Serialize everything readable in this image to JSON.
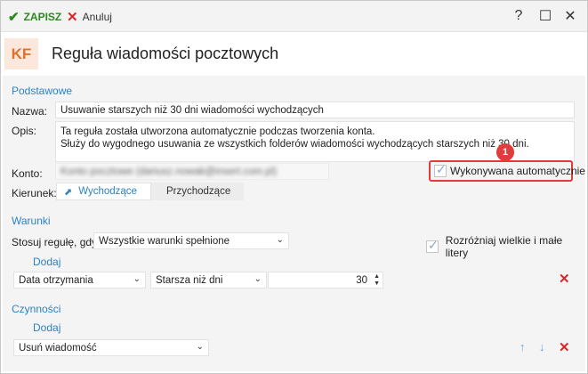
{
  "toolbar": {
    "save_label": "ZAPISZ",
    "cancel_label": "Anuluj",
    "help": "?",
    "maximize": "☐",
    "close": "✕"
  },
  "header": {
    "logo": "KF",
    "title": "Reguła wiadomości pocztowych"
  },
  "basic": {
    "section_title": "Podstawowe",
    "name_label": "Nazwa:",
    "name_value": "Usuwanie starszych niż 30 dni wiadomości wychodzących",
    "desc_label": "Opis:",
    "desc_line1": "Ta reguła została utworzona automatycznie podczas tworzenia konta.",
    "desc_line2": "Służy do wygodnego usuwania ze wszystkich folderów wiadomości wychodzących starszych niż 30 dni.",
    "account_label": "Konto:",
    "account_value": "Konto pocztowe (dariusz.nowak@insert.com.pl)",
    "auto_label": "Wykonywana automatycznie",
    "badge": "1",
    "direction_label": "Kierunek:",
    "dir_outgoing": "Wychodzące",
    "dir_incoming": "Przychodzące"
  },
  "conditions": {
    "section_title": "Warunki",
    "apply_label": "Stosuj regułę, gdy:",
    "apply_value": "Wszystkie warunki spełnione",
    "case_label": "Rozróżniaj wielkie i małe litery",
    "add_label": "Dodaj",
    "field_value": "Data otrzymania",
    "operator_value": "Starsza niż dni",
    "number_value": "30"
  },
  "actions": {
    "section_title": "Czynności",
    "add_label": "Dodaj",
    "action_value": "Usuń wiadomość"
  },
  "colors": {
    "accent": "#2b82c4",
    "save": "#2c8a1e",
    "danger": "#d62828",
    "logo_bg": "#fbe7dc",
    "logo_fg": "#e0712c"
  },
  "icons": {
    "save": "checkmark-icon",
    "cancel": "close-icon",
    "delete": "delete-x-icon",
    "move_up": "arrow-up-icon",
    "move_down": "arrow-down-icon",
    "direction": "outgoing-arrow-icon"
  }
}
